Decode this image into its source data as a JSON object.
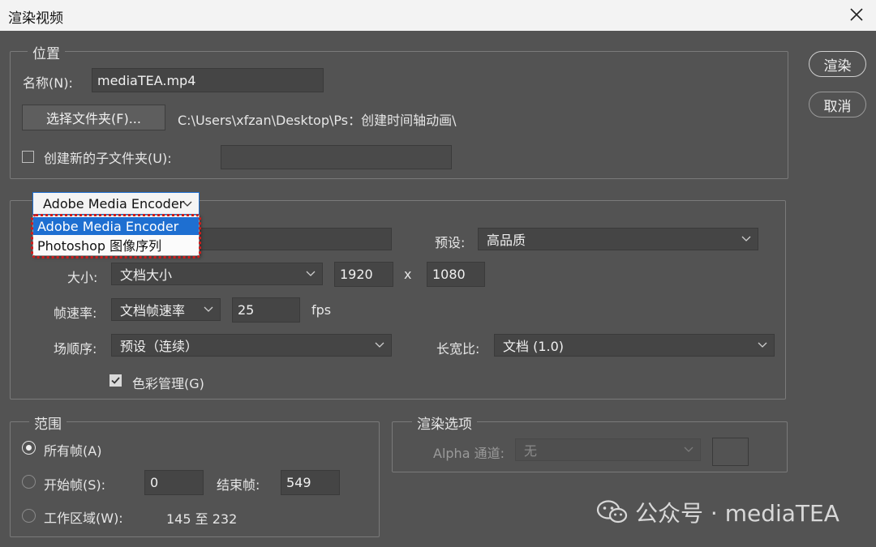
{
  "window": {
    "title": "渲染视频"
  },
  "location": {
    "legend": "位置",
    "name_label": "名称(N):",
    "name_value": "mediaTEA.mp4",
    "choose_folder_label": "选择文件夹(F)...",
    "folder_path": "C:\\Users\\xfzan\\Desktop\\Ps：创建时间轴动画\\",
    "subfolder_label": "创建新的子文件夹(U):",
    "subfolder_checked": false,
    "subfolder_value": ""
  },
  "encoder": {
    "selected": "Adobe Media Encoder",
    "options": [
      "Adobe Media Encoder",
      "Photoshop 图像序列"
    ],
    "highlight_color": "#d11b1b",
    "selection_color": "#1e6fd1"
  },
  "format": {
    "format_value": "",
    "preset_label": "预设:",
    "preset_value": "高品质",
    "size_label": "大小:",
    "size_value": "文档大小",
    "width": "1920",
    "x_sep": "x",
    "height": "1080",
    "fps_label": "帧速率:",
    "fps_mode": "文档帧速率",
    "fps_value": "25",
    "fps_unit": "fps",
    "field_order_label": "场顺序:",
    "field_order_value": "预设（连续）",
    "aspect_label": "长宽比:",
    "aspect_value": "文档 (1.0)",
    "color_mgmt_label": "色彩管理(G)",
    "color_mgmt_checked": true
  },
  "range": {
    "legend": "范围",
    "all_frames_label": "所有帧(A)",
    "start_frame_label": "开始帧(S):",
    "start_frame_value": "0",
    "end_frame_label": "结束帧:",
    "end_frame_value": "549",
    "work_area_label": "工作区域(W):",
    "work_area_value": "145 至 232",
    "selected": "all_frames"
  },
  "render_options": {
    "legend": "渲染选项",
    "alpha_label": "Alpha 通道:",
    "alpha_value": "无"
  },
  "actions": {
    "render_label": "渲染",
    "cancel_label": "取消"
  },
  "watermark": {
    "text": "公众号 · mediaTEA"
  },
  "icons": {
    "close": "close-icon",
    "dropdown": "chevron-down-icon",
    "check": "check-icon",
    "watermark": "wechat-icon"
  }
}
